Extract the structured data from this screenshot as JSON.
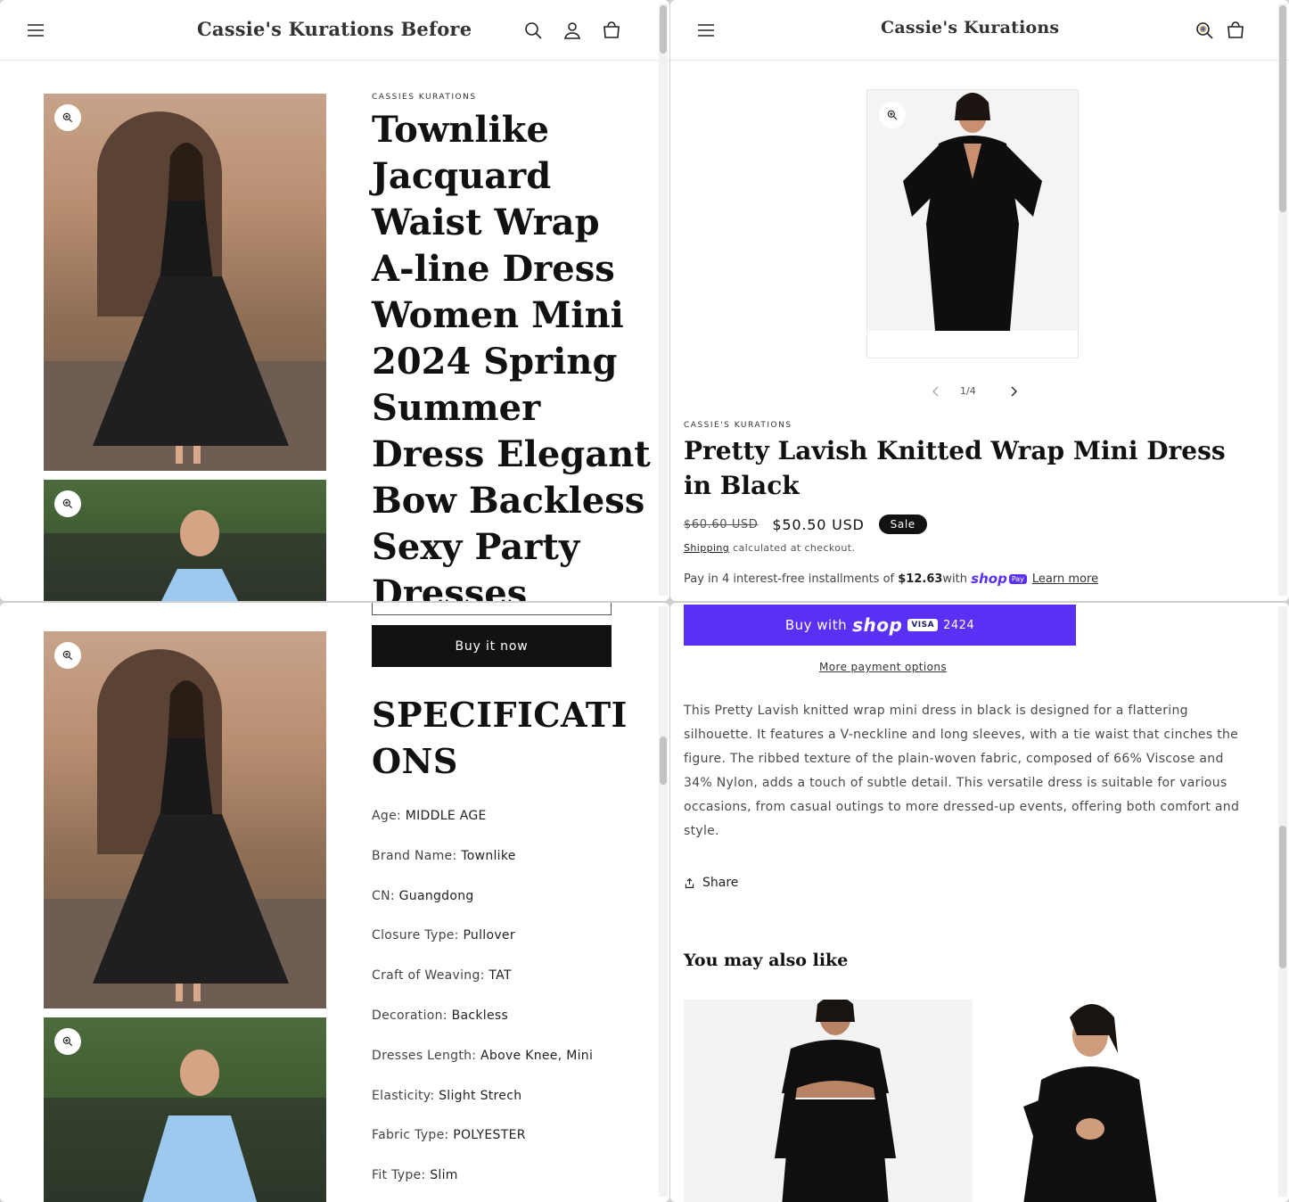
{
  "left_store": {
    "logo": "Cassie's Kurations Before",
    "vendor": "CASSIES KURATIONS",
    "title_lines": [
      "Townlike",
      "Jacquard",
      "Waist Wrap",
      "A-line Dress",
      "Women Mini",
      "2024 Spring",
      "Summer",
      "Dress Elegant",
      "Bow Backless",
      "Sexy Party",
      "Dresses"
    ],
    "buy_now_label": "Buy it now",
    "specs_heading_lines": [
      "SPECIFICATI",
      "ONS"
    ],
    "specs": [
      {
        "label": "Age: ",
        "value": "MIDDLE AGE"
      },
      {
        "label": "Brand Name: ",
        "value": "Townlike"
      },
      {
        "label": "CN: ",
        "value": "Guangdong"
      },
      {
        "label": "Closure Type: ",
        "value": "Pullover"
      },
      {
        "label": "Craft of Weaving: ",
        "value": "TAT"
      },
      {
        "label": "Decoration: ",
        "value": "Backless"
      },
      {
        "label": "Dresses Length: ",
        "value": "Above Knee, Mini"
      },
      {
        "label": "Elasticity: ",
        "value": "Slight Strech"
      },
      {
        "label": "Fabric Type: ",
        "value": "POLYESTER"
      },
      {
        "label": "Fit Type: ",
        "value": "Slim"
      }
    ]
  },
  "right_store": {
    "logo": "Cassie's Kurations",
    "slider_counter": "1/4",
    "vendor": "CASSIE'S KURATIONS",
    "title": "Pretty Lavish Knitted Wrap Mini Dress in Black",
    "price_old": "$60.60 USD",
    "price_new": "$50.50 USD",
    "sale_badge": "Sale",
    "shipping_link": "Shipping",
    "shipping_text": " calculated at checkout.",
    "installments_prefix": "Pay in 4 interest-free installments of ",
    "installments_amount": "$12.63",
    "installments_with": " with ",
    "shop_pay_word": "shop",
    "shop_pay_badge": "Pay",
    "learn_more": "Learn more",
    "buy_with_label": "Buy with",
    "buy_with_brand": "shop",
    "visa_label": "VISA",
    "card_last4": "2424",
    "more_payment_options": "More payment options",
    "description": "This Pretty Lavish knitted wrap mini dress in black is designed for a flattering silhouette. It features a V-neckline and long sleeves, with a tie waist that cinches the figure. The ribbed texture of the plain-woven fabric, composed of 66% Viscose and 34% Nylon, adds a touch of subtle detail. This versatile dress is suitable for various occasions, from casual outings to more dressed-up events, offering both comfort and style.",
    "share_label": "Share",
    "also_like_heading": "You may also like"
  },
  "icons": {
    "menu": "menu-icon",
    "search": "search-icon",
    "account": "account-icon",
    "cart": "cart-icon",
    "zoom": "zoom-icon",
    "share": "share-icon",
    "chevron_left": "chevron-left-icon",
    "chevron_right": "chevron-right-icon"
  },
  "colors": {
    "shop_pay_purple": "#5a31f4",
    "text": "#121212",
    "button_dark": "#121212"
  }
}
